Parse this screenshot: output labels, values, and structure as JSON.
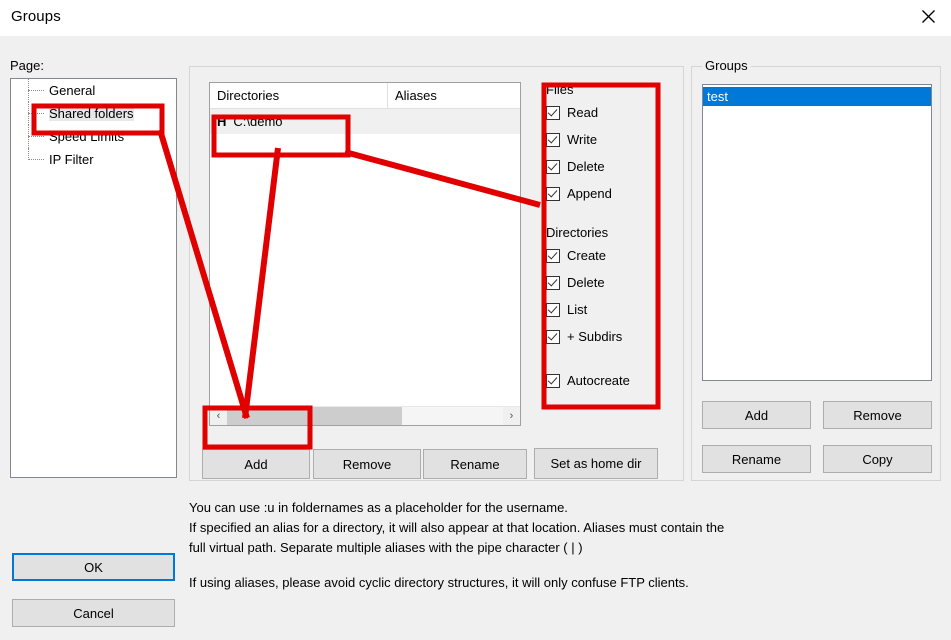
{
  "window": {
    "title": "Groups",
    "close_icon": "close-icon"
  },
  "sidebar": {
    "label": "Page:",
    "items": [
      {
        "label": "General",
        "selected": false
      },
      {
        "label": "Shared folders",
        "selected": true
      },
      {
        "label": "Speed Limits",
        "selected": false
      },
      {
        "label": "IP Filter",
        "selected": false
      }
    ]
  },
  "shared_folders": {
    "listview": {
      "columns": [
        "Directories",
        "Aliases"
      ],
      "rows": [
        {
          "home_flag": "H",
          "directory": "C:\\demo",
          "alias": ""
        }
      ],
      "hscroll": {
        "left_arrow": "‹",
        "right_arrow": "›"
      }
    },
    "buttons": {
      "add": "Add",
      "remove": "Remove",
      "rename": "Rename",
      "set_as_home_dir": "Set as home dir"
    },
    "permissions": {
      "files_label": "Files",
      "files": [
        {
          "label": "Read",
          "checked": true
        },
        {
          "label": "Write",
          "checked": true
        },
        {
          "label": "Delete",
          "checked": true
        },
        {
          "label": "Append",
          "checked": true
        }
      ],
      "directories_label": "Directories",
      "directories": [
        {
          "label": "Create",
          "checked": true
        },
        {
          "label": "Delete",
          "checked": true
        },
        {
          "label": "List",
          "checked": true
        },
        {
          "label": "+ Subdirs",
          "checked": true
        }
      ],
      "autocreate": {
        "label": "Autocreate",
        "checked": true
      }
    }
  },
  "groups_panel": {
    "legend": "Groups",
    "items": [
      {
        "label": "test",
        "selected": true
      }
    ],
    "buttons": {
      "add": "Add",
      "remove": "Remove",
      "rename": "Rename",
      "copy": "Copy"
    }
  },
  "help": {
    "line1": "You can use :u in foldernames as a placeholder for the username.",
    "line2": "If specified an alias for a directory, it will also appear at that location. Aliases must contain the",
    "line3": "full virtual path. Separate multiple aliases with the pipe character ( | )",
    "line4": "If using aliases, please avoid cyclic directory structures, it will only confuse FTP clients."
  },
  "dialog_buttons": {
    "ok": "OK",
    "cancel": "Cancel"
  },
  "colors": {
    "accent_blue": "#0078d7",
    "annotation_red": "#e00000",
    "dialog_background": "#f0f0f0",
    "button_face": "#e1e1e1"
  }
}
